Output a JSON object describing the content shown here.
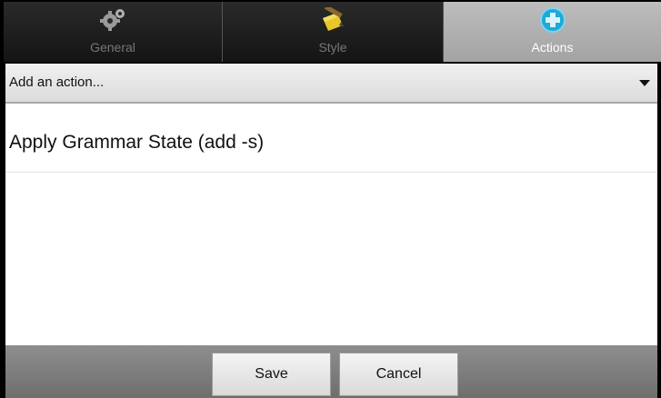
{
  "tabs": [
    {
      "label": "General",
      "icon": "gears-icon",
      "active": false
    },
    {
      "label": "Style",
      "icon": "pencil-note-icon",
      "active": false
    },
    {
      "label": "Actions",
      "icon": "plus-circle-icon",
      "active": true
    }
  ],
  "action_picker": {
    "placeholder": "Add an action..."
  },
  "actions": [
    {
      "label": "Apply Grammar State (add -s)"
    }
  ],
  "buttons": {
    "save": "Save",
    "cancel": "Cancel"
  },
  "colors": {
    "active_tab": "#b2b2b2",
    "accent_plus": "#1fa9d6",
    "style_icon": "#e8c62c"
  }
}
